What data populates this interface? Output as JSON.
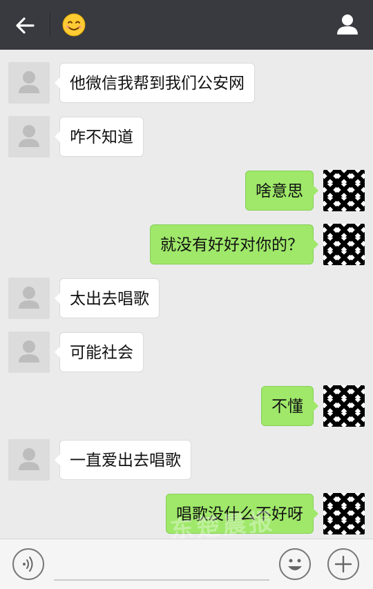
{
  "header": {
    "back_icon": "arrow-left-icon",
    "contact_icon": "smiling-face-emoji-icon",
    "profile_icon": "person-icon"
  },
  "messages": [
    {
      "side": "left",
      "text": "他微信我帮到我们公安网"
    },
    {
      "side": "left",
      "text": "咋不知道"
    },
    {
      "side": "right",
      "text": "啥意思"
    },
    {
      "side": "right",
      "text": "就没有好好对你的？"
    },
    {
      "side": "left",
      "text": "太出去唱歌"
    },
    {
      "side": "left",
      "text": "可能社会"
    },
    {
      "side": "right",
      "text": "不懂"
    },
    {
      "side": "left",
      "text": "一直爱出去唱歌"
    },
    {
      "side": "right",
      "text": "唱歌没什么不好呀"
    }
  ],
  "footer": {
    "voice_icon": "voice-icon",
    "emoji_icon": "emoji-face-icon",
    "plus_icon": "plus-icon"
  },
  "watermark": "东楚晨报",
  "colors": {
    "topbar": "#393a3f",
    "chat_bg": "#ebebeb",
    "bubble_left": "#ffffff",
    "bubble_right": "#9fe86a"
  }
}
